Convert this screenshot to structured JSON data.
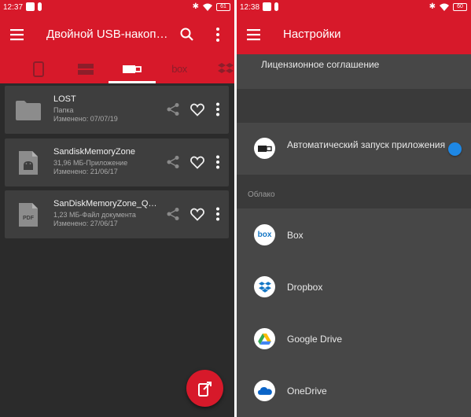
{
  "left_screen": {
    "status_bar": {
      "time": "12:37",
      "battery": "61"
    },
    "appbar": {
      "title": "Двойной USB-накопитель"
    },
    "tabs": [
      {
        "icon": "phone-icon"
      },
      {
        "icon": "sd-card-icon"
      },
      {
        "icon": "usb-icon",
        "selected": true
      },
      {
        "label": "box"
      },
      {
        "icon": "dropbox-icon"
      }
    ],
    "files": [
      {
        "name": "LOST",
        "type": "Папка",
        "modified": "Изменено: 07/07/19",
        "icon": "folder-icon"
      },
      {
        "name": "SandiskMemoryZone",
        "type": "31,96 МБ-Приложение",
        "modified": "Изменено: 21/06/17",
        "icon": "android-file-icon"
      },
      {
        "name": "SanDiskMemoryZone_QuickStartGuide",
        "type": "1,23 МБ-Файл документа",
        "modified": "Изменено: 27/06/17",
        "icon": "pdf-file-icon",
        "thumb_label": "PDF"
      }
    ]
  },
  "right_screen": {
    "status_bar": {
      "time": "12:38",
      "battery": "60"
    },
    "appbar": {
      "title": "Настройки"
    },
    "license": "Лицензионное соглашение",
    "autolaunch": {
      "label": "Автоматический запуск приложения с Dual Drive",
      "enabled": true
    },
    "cloud_header": "Облако",
    "cloud_items": [
      {
        "label": "Box",
        "icon_text": "box"
      },
      {
        "label": "Dropbox"
      },
      {
        "label": "Google Drive"
      },
      {
        "label": "OneDrive"
      }
    ]
  },
  "colors": {
    "accent": "#d7192a",
    "toggle": "#1e88e5",
    "background": "#2b2b2b",
    "card": "#3e3e3e"
  }
}
